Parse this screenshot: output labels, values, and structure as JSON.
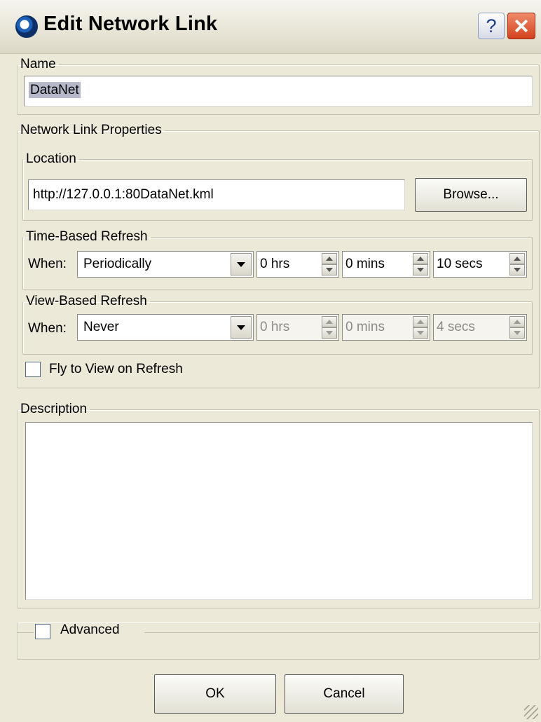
{
  "window": {
    "title": "Edit Network Link",
    "help_label": "?"
  },
  "name_group": {
    "label": "Name",
    "value": "DataNet"
  },
  "properties": {
    "label": "Network Link Properties",
    "location": {
      "label": "Location",
      "value": "http://127.0.0.1:80DataNet.kml",
      "browse_label": "Browse..."
    },
    "time_refresh": {
      "label": "Time-Based Refresh",
      "when_label": "When:",
      "when_value": "Periodically",
      "hrs": "0 hrs",
      "mins": "0 mins",
      "secs": "10 secs"
    },
    "view_refresh": {
      "label": "View-Based Refresh",
      "when_label": "When:",
      "when_value": "Never",
      "hrs": "0 hrs",
      "mins": "0 mins",
      "secs": "4 secs"
    },
    "fly_to_view": {
      "label": "Fly to View on Refresh",
      "checked": false
    }
  },
  "description": {
    "label": "Description",
    "value": ""
  },
  "advanced": {
    "label": "Advanced",
    "checked": false
  },
  "buttons": {
    "ok": "OK",
    "cancel": "Cancel"
  }
}
